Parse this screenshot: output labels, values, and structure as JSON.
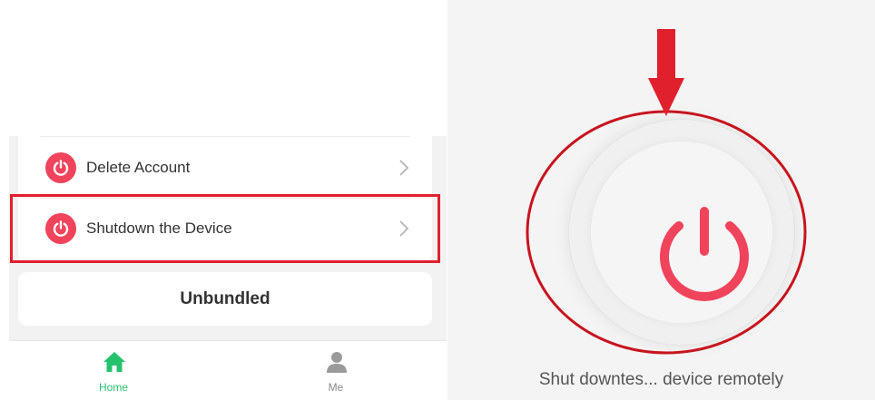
{
  "menu": {
    "items": [
      {
        "label": "Delete Account",
        "icon": "power-icon"
      },
      {
        "label": "Shutdown the Device",
        "icon": "power-icon"
      }
    ],
    "highlighted_item": "Shutdown the Device"
  },
  "unbundled_button": {
    "label": "Unbundled"
  },
  "tab_bar": {
    "tabs": [
      {
        "label": "Home",
        "icon": "home-icon",
        "active": true
      },
      {
        "label": "Me",
        "icon": "person-icon",
        "active": false
      }
    ]
  },
  "power_screen": {
    "button_icon": "power-icon",
    "caption": "Shut downtes... device remotely"
  },
  "colors": {
    "accent_red": "#f0435c",
    "annotation_red": "#e0202d",
    "active_tab_green": "#25c26e",
    "panel_background": "#f2f2f2"
  }
}
